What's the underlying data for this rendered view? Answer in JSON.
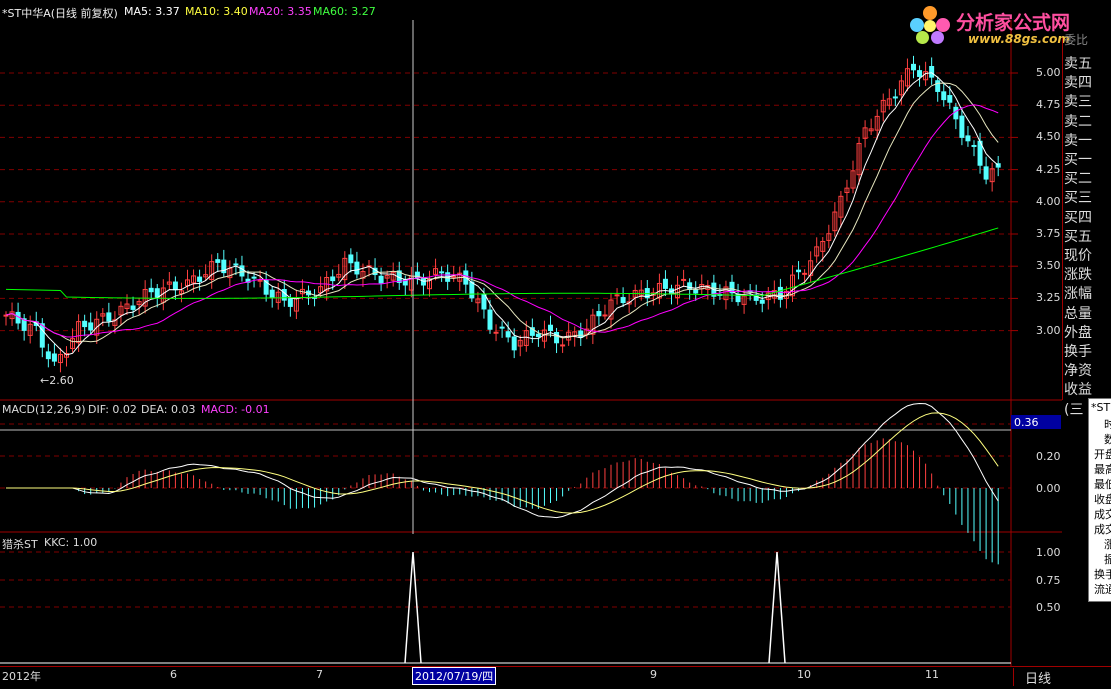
{
  "header": {
    "title": "*ST中华A(日线 前复权)",
    "ma5": "MA5: 3.37",
    "ma10": "MA10: 3.40",
    "ma20": "MA20: 3.35",
    "ma60": "MA60: 3.27"
  },
  "logo": {
    "text": "分析家公式网",
    "url": "www.88gs.com"
  },
  "sidebar": {
    "top_label": "委比",
    "items": [
      "卖五",
      "卖四",
      "卖三",
      "卖二",
      "卖一",
      "买一",
      "买二",
      "买三",
      "买四",
      "买五",
      "现价",
      "涨跌",
      "涨幅",
      "总量",
      "外盘",
      "换手",
      "净资",
      "收益(三"
    ]
  },
  "price_axis": [
    "5.00",
    "4.75",
    "4.50",
    "4.25",
    "4.00",
    "3.75",
    "3.50",
    "3.25",
    "3.00"
  ],
  "low_marker": "2.60",
  "macd": {
    "title": "MACD(12,26,9)",
    "dif": "DIF: 0.02",
    "dea": "DEA: 0.03",
    "macd": "MACD: -0.01",
    "axis": [
      "0.36",
      "0.20",
      "0.00"
    ]
  },
  "kkc": {
    "title": "猎杀ST",
    "value": "KKC: 1.00",
    "axis": [
      "1.00",
      "0.75",
      "0.50"
    ]
  },
  "date_axis": {
    "labels": [
      "2012年",
      "6",
      "7",
      "9",
      "10",
      "11"
    ],
    "cursor_date": "2012/07/19/四",
    "period": "日线"
  },
  "popup": {
    "title": "*ST",
    "rows": [
      "时",
      "数",
      "开盘",
      "最高",
      "最低",
      "收盘",
      "成交",
      "成交",
      "涨",
      "振",
      "换手",
      "流通"
    ]
  },
  "colors": {
    "up": "#ff4040",
    "down": "#54ffff",
    "ma5": "#ffffff",
    "ma10": "#ffff00",
    "ma20": "#ff00ff",
    "ma60": "#00ff00",
    "grid": "#800000",
    "axis_line": "#a00000"
  }
}
